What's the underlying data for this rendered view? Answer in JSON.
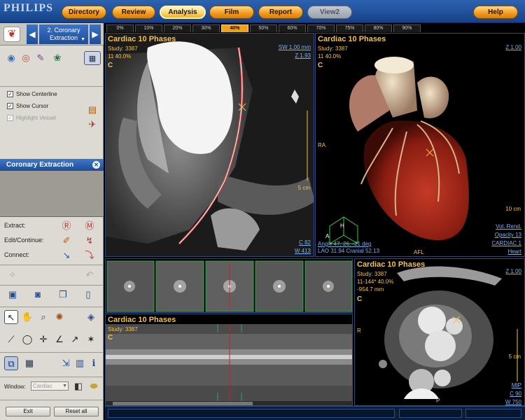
{
  "logo": "PHILIPS",
  "nav": {
    "directory": "Directory",
    "review": "Review",
    "analysis": "Analysis",
    "film": "Film",
    "report": "Report",
    "view2": "View2",
    "help": "Help"
  },
  "protocol": {
    "step_label_line1": "2. Coronary",
    "step_label_line2": "Extraction"
  },
  "options": {
    "show_centerline": "Show Centerline",
    "show_cursor": "Show Cursor",
    "highlight_vessel": "Highlight Vessel"
  },
  "coronary_panel": {
    "title": "Coronary Extraction"
  },
  "extract": {
    "extract_label": "Extract:",
    "edit_label": "Edit/Continue:",
    "connect_label": "Connect:"
  },
  "window": {
    "label": "Window:",
    "preset": "Cardiac"
  },
  "buttons": {
    "exit": "Exit",
    "reset_all": "Reset all"
  },
  "phases": [
    "0%",
    "10%",
    "20%",
    "30%",
    "40%",
    "50%",
    "60%",
    "70%",
    "75%",
    "80%",
    "90%"
  ],
  "active_phase": "40%",
  "vp1": {
    "title": "Cardiac 10 Phases",
    "study": "Study: 3387",
    "phase": "11 40.0%",
    "c": "C",
    "sw": "SW 1.00 mm",
    "zoom": "Z 1.93",
    "scale": "5 cm",
    "c_val": "C     82",
    "w_val": "W   413"
  },
  "vp2": {
    "title": "Cardiac 10 Phases",
    "study": "Study: 3387",
    "phase": "11 40.0%",
    "c": "C",
    "zoom": "Z 1.00",
    "ra": "RA",
    "afl": "AFL",
    "scale": "10 cm",
    "angle": "Angle 47, 26, -21 deg",
    "lao": "LAO 31.94  Cranial 52.13",
    "vol_rend": "Vol. Rend.",
    "opacity": "Opacity 13",
    "cardiac": "CARDIAC 1",
    "heart": "Heart",
    "cube_h": "H",
    "cube_a": "A"
  },
  "vp3": {
    "title": "Cardiac 10 Phases",
    "study": "Study: 3387",
    "c": "C"
  },
  "vp4": {
    "title": "Cardiac 10 Phases",
    "study": "Study: 3387",
    "phase": "11-144* 40.0%",
    "position": "-954.7 mm",
    "c": "C",
    "zoom": "Z 1.00",
    "r": "R",
    "p": "P",
    "scale": "5 cm",
    "mip": "MIP",
    "c_val": "C    90",
    "w_val": "W   750"
  }
}
